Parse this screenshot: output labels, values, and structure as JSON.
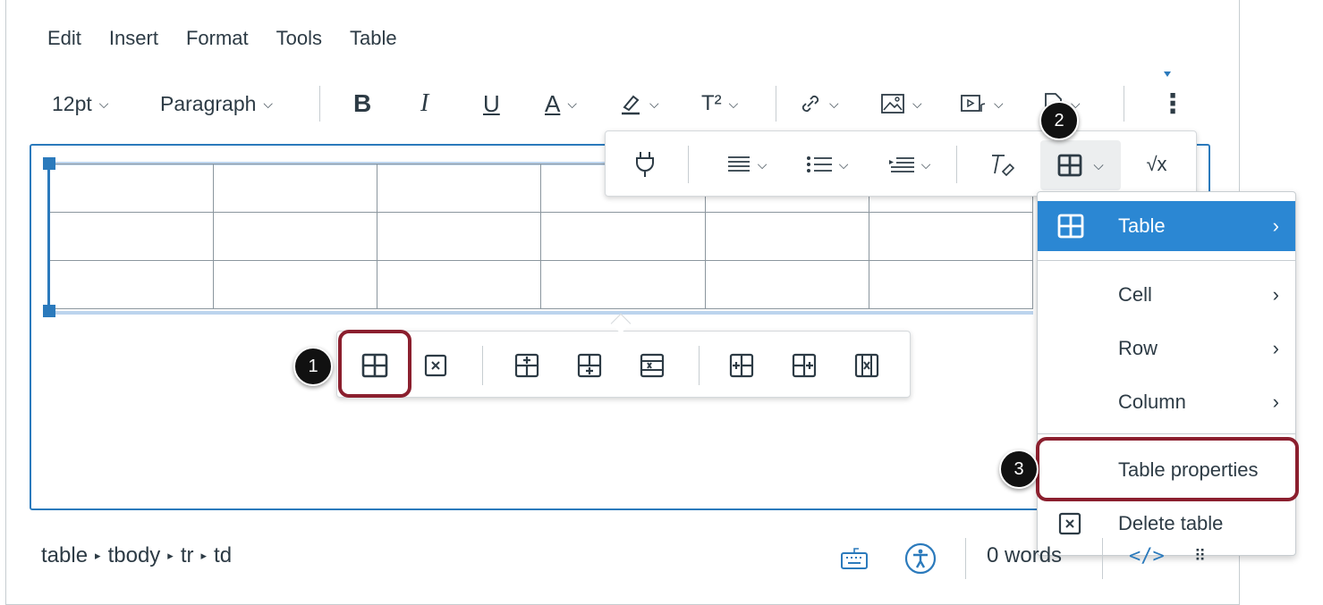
{
  "menubar": [
    "Edit",
    "Insert",
    "Format",
    "Tools",
    "Table"
  ],
  "toolbar": {
    "font_size": "12pt",
    "block_format": "Paragraph",
    "bold": "B",
    "italic": "I",
    "underline": "U",
    "text_color": "A",
    "superscript": "T²",
    "more": "⋮"
  },
  "table_toolbar": {
    "math": "√x"
  },
  "badges": [
    "1",
    "2",
    "3"
  ],
  "table_menu": {
    "items": [
      {
        "label": "Table",
        "submenu": true,
        "active": true
      },
      {
        "label": "Cell",
        "submenu": true
      },
      {
        "label": "Row",
        "submenu": true
      },
      {
        "label": "Column",
        "submenu": true
      },
      {
        "label": "Table properties",
        "submenu": false
      },
      {
        "label": "Delete table",
        "submenu": false
      }
    ]
  },
  "statusbar": {
    "path": [
      "table",
      "tbody",
      "tr",
      "td"
    ],
    "words": "0 words"
  },
  "colors": {
    "accent": "#2b7abc",
    "menu_active": "#2b87d3",
    "highlight_box": "#8b1f2e",
    "text": "#2d3b45"
  }
}
